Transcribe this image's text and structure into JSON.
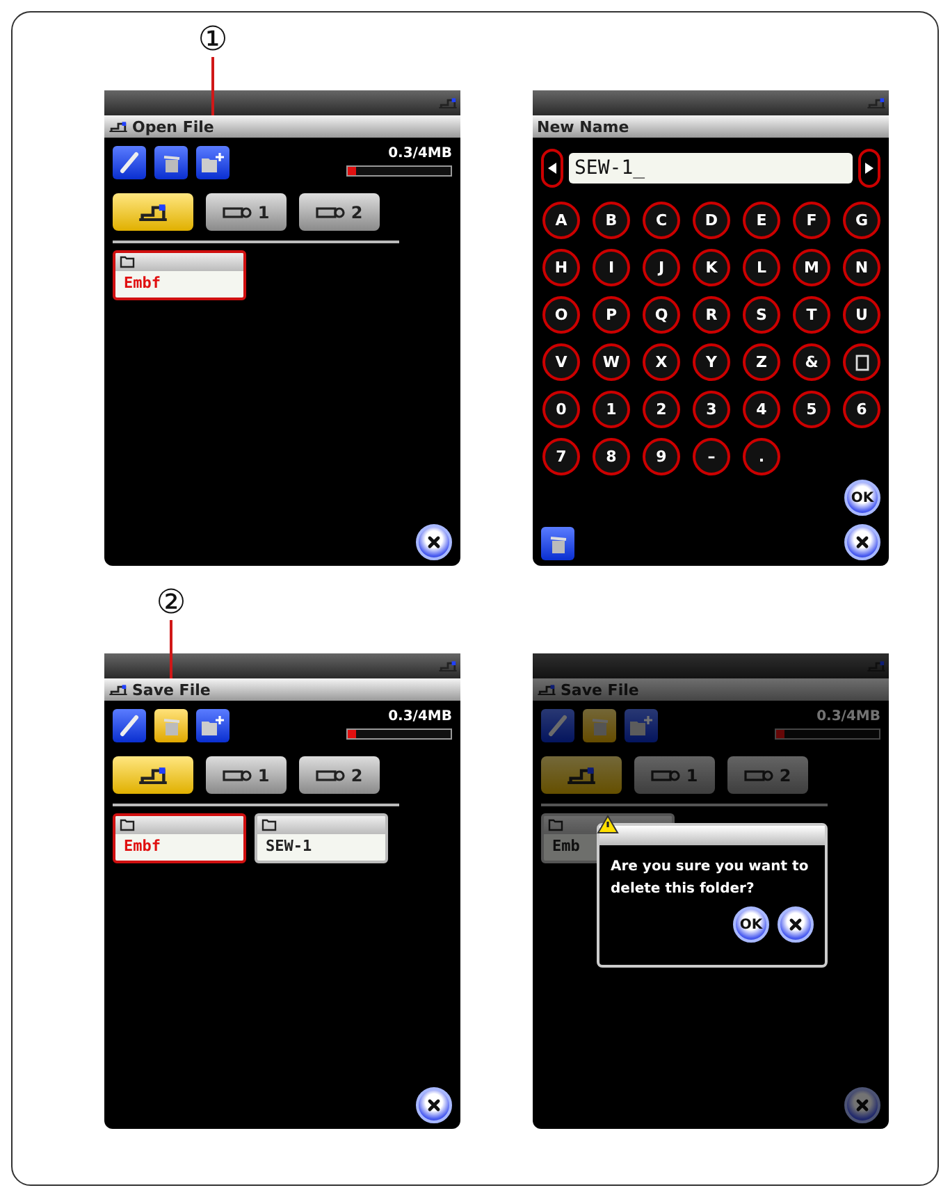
{
  "panels": [
    {
      "kind": "file",
      "title": "Open File",
      "tools": [
        {
          "kind": "edit",
          "selected": false
        },
        {
          "kind": "delete",
          "selected": false
        },
        {
          "kind": "new_folder",
          "selected": false,
          "callout": "①"
        }
      ],
      "storage": {
        "text": "0.3/4MB",
        "level": 0.075
      },
      "sources": [
        {
          "kind": "machine",
          "selected": true
        },
        {
          "kind": "usb",
          "label": "1",
          "selected": false
        },
        {
          "kind": "usb",
          "label": "2",
          "selected": false
        }
      ],
      "folders": [
        {
          "name": "Embf",
          "selected": true
        }
      ],
      "dimmed": false
    },
    {
      "kind": "keyboard",
      "title": "New Name",
      "value": "SEW-1_",
      "confirm": "OK",
      "keys": [
        {
          "kind": "char",
          "label": "A"
        },
        {
          "kind": "char",
          "label": "B"
        },
        {
          "kind": "char",
          "label": "C"
        },
        {
          "kind": "char",
          "label": "D"
        },
        {
          "kind": "char",
          "label": "E"
        },
        {
          "kind": "char",
          "label": "F"
        },
        {
          "kind": "char",
          "label": "G"
        },
        {
          "kind": "char",
          "label": "H"
        },
        {
          "kind": "char",
          "label": "I"
        },
        {
          "kind": "char",
          "label": "J"
        },
        {
          "kind": "char",
          "label": "K"
        },
        {
          "kind": "char",
          "label": "L"
        },
        {
          "kind": "char",
          "label": "M"
        },
        {
          "kind": "char",
          "label": "N"
        },
        {
          "kind": "char",
          "label": "O"
        },
        {
          "kind": "char",
          "label": "P"
        },
        {
          "kind": "char",
          "label": "Q"
        },
        {
          "kind": "char",
          "label": "R"
        },
        {
          "kind": "char",
          "label": "S"
        },
        {
          "kind": "char",
          "label": "T"
        },
        {
          "kind": "char",
          "label": "U"
        },
        {
          "kind": "char",
          "label": "V"
        },
        {
          "kind": "char",
          "label": "W"
        },
        {
          "kind": "char",
          "label": "X"
        },
        {
          "kind": "char",
          "label": "Y"
        },
        {
          "kind": "char",
          "label": "Z"
        },
        {
          "kind": "char",
          "label": "&"
        },
        {
          "kind": "space"
        },
        {
          "kind": "char",
          "label": "0"
        },
        {
          "kind": "char",
          "label": "1"
        },
        {
          "kind": "char",
          "label": "2"
        },
        {
          "kind": "char",
          "label": "3"
        },
        {
          "kind": "char",
          "label": "4"
        },
        {
          "kind": "char",
          "label": "5"
        },
        {
          "kind": "char",
          "label": "6"
        },
        {
          "kind": "char",
          "label": "7"
        },
        {
          "kind": "char",
          "label": "8"
        },
        {
          "kind": "char",
          "label": "9"
        },
        {
          "kind": "char",
          "label": "–"
        },
        {
          "kind": "char",
          "label": "."
        }
      ]
    },
    {
      "kind": "file",
      "title": "Save File",
      "tools": [
        {
          "kind": "edit",
          "selected": false
        },
        {
          "kind": "delete",
          "selected": true,
          "callout": "②"
        },
        {
          "kind": "new_folder",
          "selected": false
        }
      ],
      "storage": {
        "text": "0.3/4MB",
        "level": 0.075
      },
      "sources": [
        {
          "kind": "machine",
          "selected": true
        },
        {
          "kind": "usb",
          "label": "1",
          "selected": false
        },
        {
          "kind": "usb",
          "label": "2",
          "selected": false
        }
      ],
      "folders": [
        {
          "name": "Embf",
          "selected": true
        },
        {
          "name": "SEW-1",
          "selected": false
        }
      ],
      "dimmed": false
    },
    {
      "kind": "file",
      "title": "Save File",
      "tools": [
        {
          "kind": "edit",
          "selected": false
        },
        {
          "kind": "delete",
          "selected": true
        },
        {
          "kind": "new_folder",
          "selected": false
        }
      ],
      "storage": {
        "text": "0.3/4MB",
        "level": 0.075
      },
      "sources": [
        {
          "kind": "machine",
          "selected": true
        },
        {
          "kind": "usb",
          "label": "1",
          "selected": false
        },
        {
          "kind": "usb",
          "label": "2",
          "selected": false
        }
      ],
      "folders": [
        {
          "name": "Emb",
          "selected": false
        }
      ],
      "dimmed": true,
      "dialog": {
        "message": "Are you sure you want to delete this folder?",
        "confirm": "OK"
      }
    }
  ]
}
